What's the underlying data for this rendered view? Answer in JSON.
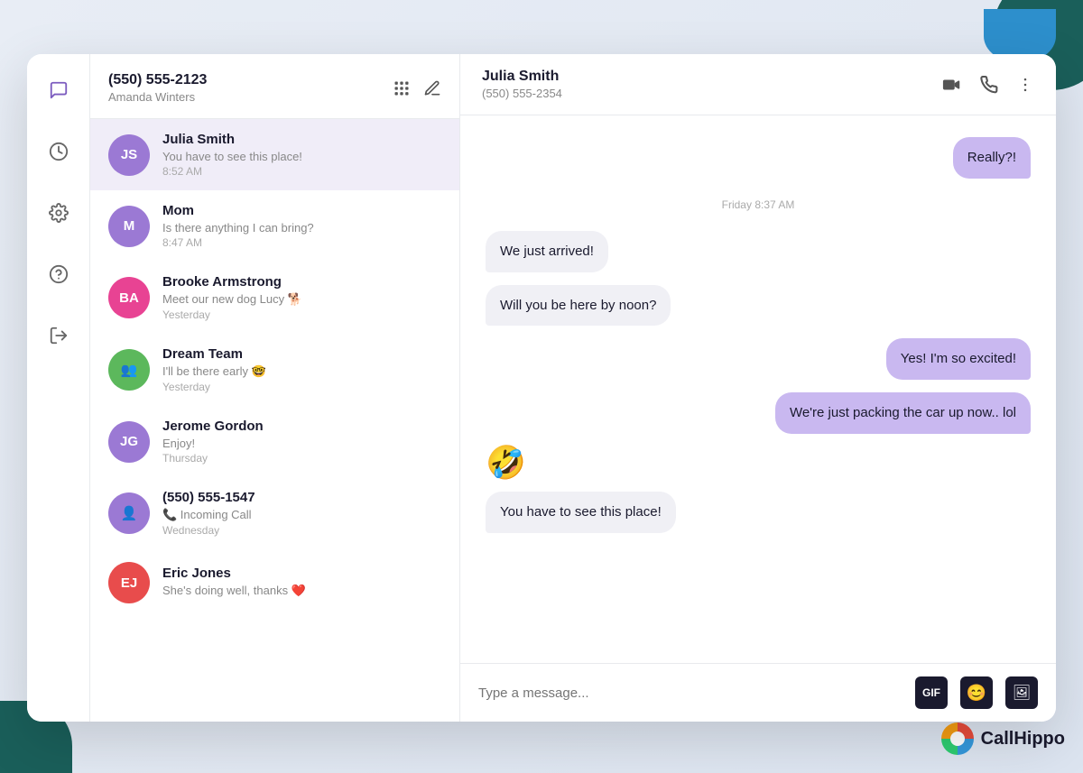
{
  "background": {
    "brand_name": "CallHippo"
  },
  "window": {
    "traffic_lights": [
      "red",
      "yellow",
      "green"
    ]
  },
  "header": {
    "phone_number": "(550) 555-2123",
    "user_name": "Amanda Winters",
    "keypad_icon": "keypad-icon",
    "compose_icon": "compose-icon"
  },
  "contacts": [
    {
      "id": "julia-smith",
      "initials": "JS",
      "avatar_class": "avatar-js",
      "name": "Julia Smith",
      "preview": "You have to see this place!",
      "time": "8:52 AM",
      "active": true
    },
    {
      "id": "mom",
      "initials": "M",
      "avatar_class": "avatar-m",
      "name": "Mom",
      "preview": "Is there anything I can bring?",
      "time": "8:47 AM",
      "active": false
    },
    {
      "id": "brooke-armstrong",
      "initials": "BA",
      "avatar_class": "avatar-ba",
      "name": "Brooke Armstrong",
      "preview": "Meet our new dog Lucy 🐕",
      "time": "Yesterday",
      "active": false
    },
    {
      "id": "dream-team",
      "initials": "👥",
      "avatar_class": "avatar-dt",
      "name": "Dream Team",
      "preview": "I'll be there early 🤓",
      "time": "Yesterday",
      "active": false
    },
    {
      "id": "jerome-gordon",
      "initials": "JG",
      "avatar_class": "avatar-jg",
      "name": "Jerome Gordon",
      "preview": "Enjoy!",
      "time": "Thursday",
      "active": false
    },
    {
      "id": "unknown-caller",
      "initials": "👤",
      "avatar_class": "avatar-phone",
      "name": "(550) 555-1547",
      "preview": "📞 Incoming Call",
      "time": "Wednesday",
      "active": false
    },
    {
      "id": "eric-jones",
      "initials": "EJ",
      "avatar_class": "avatar-ej",
      "name": "Eric Jones",
      "preview": "She's doing well, thanks ❤️",
      "time": "",
      "active": false
    }
  ],
  "chat": {
    "contact_name": "Julia Smith",
    "contact_phone": "(550) 555-2354",
    "messages": [
      {
        "type": "sent",
        "text": "Really?!",
        "time": ""
      },
      {
        "type": "divider",
        "text": "Friday 8:37 AM"
      },
      {
        "type": "received",
        "text": "We just arrived!",
        "time": ""
      },
      {
        "type": "received",
        "text": "Will you be here by noon?",
        "time": ""
      },
      {
        "type": "sent",
        "text": "Yes! I'm so excited!",
        "time": ""
      },
      {
        "type": "sent",
        "text": "We're just packing the car up now.. lol",
        "time": ""
      },
      {
        "type": "emoji",
        "text": "🤣",
        "time": ""
      },
      {
        "type": "received",
        "text": "You have to see this place!",
        "time": ""
      }
    ],
    "input_placeholder": "Type a message...",
    "gif_label": "GIF",
    "emoji_icon": "😊",
    "image_icon": "🖼"
  },
  "nav": {
    "items": [
      {
        "id": "messages",
        "icon": "💬",
        "active": true
      },
      {
        "id": "analytics",
        "icon": "📊",
        "active": false
      },
      {
        "id": "settings",
        "icon": "⚙️",
        "active": false
      },
      {
        "id": "help",
        "icon": "❓",
        "active": false
      },
      {
        "id": "logout",
        "icon": "↩",
        "active": false
      }
    ]
  }
}
